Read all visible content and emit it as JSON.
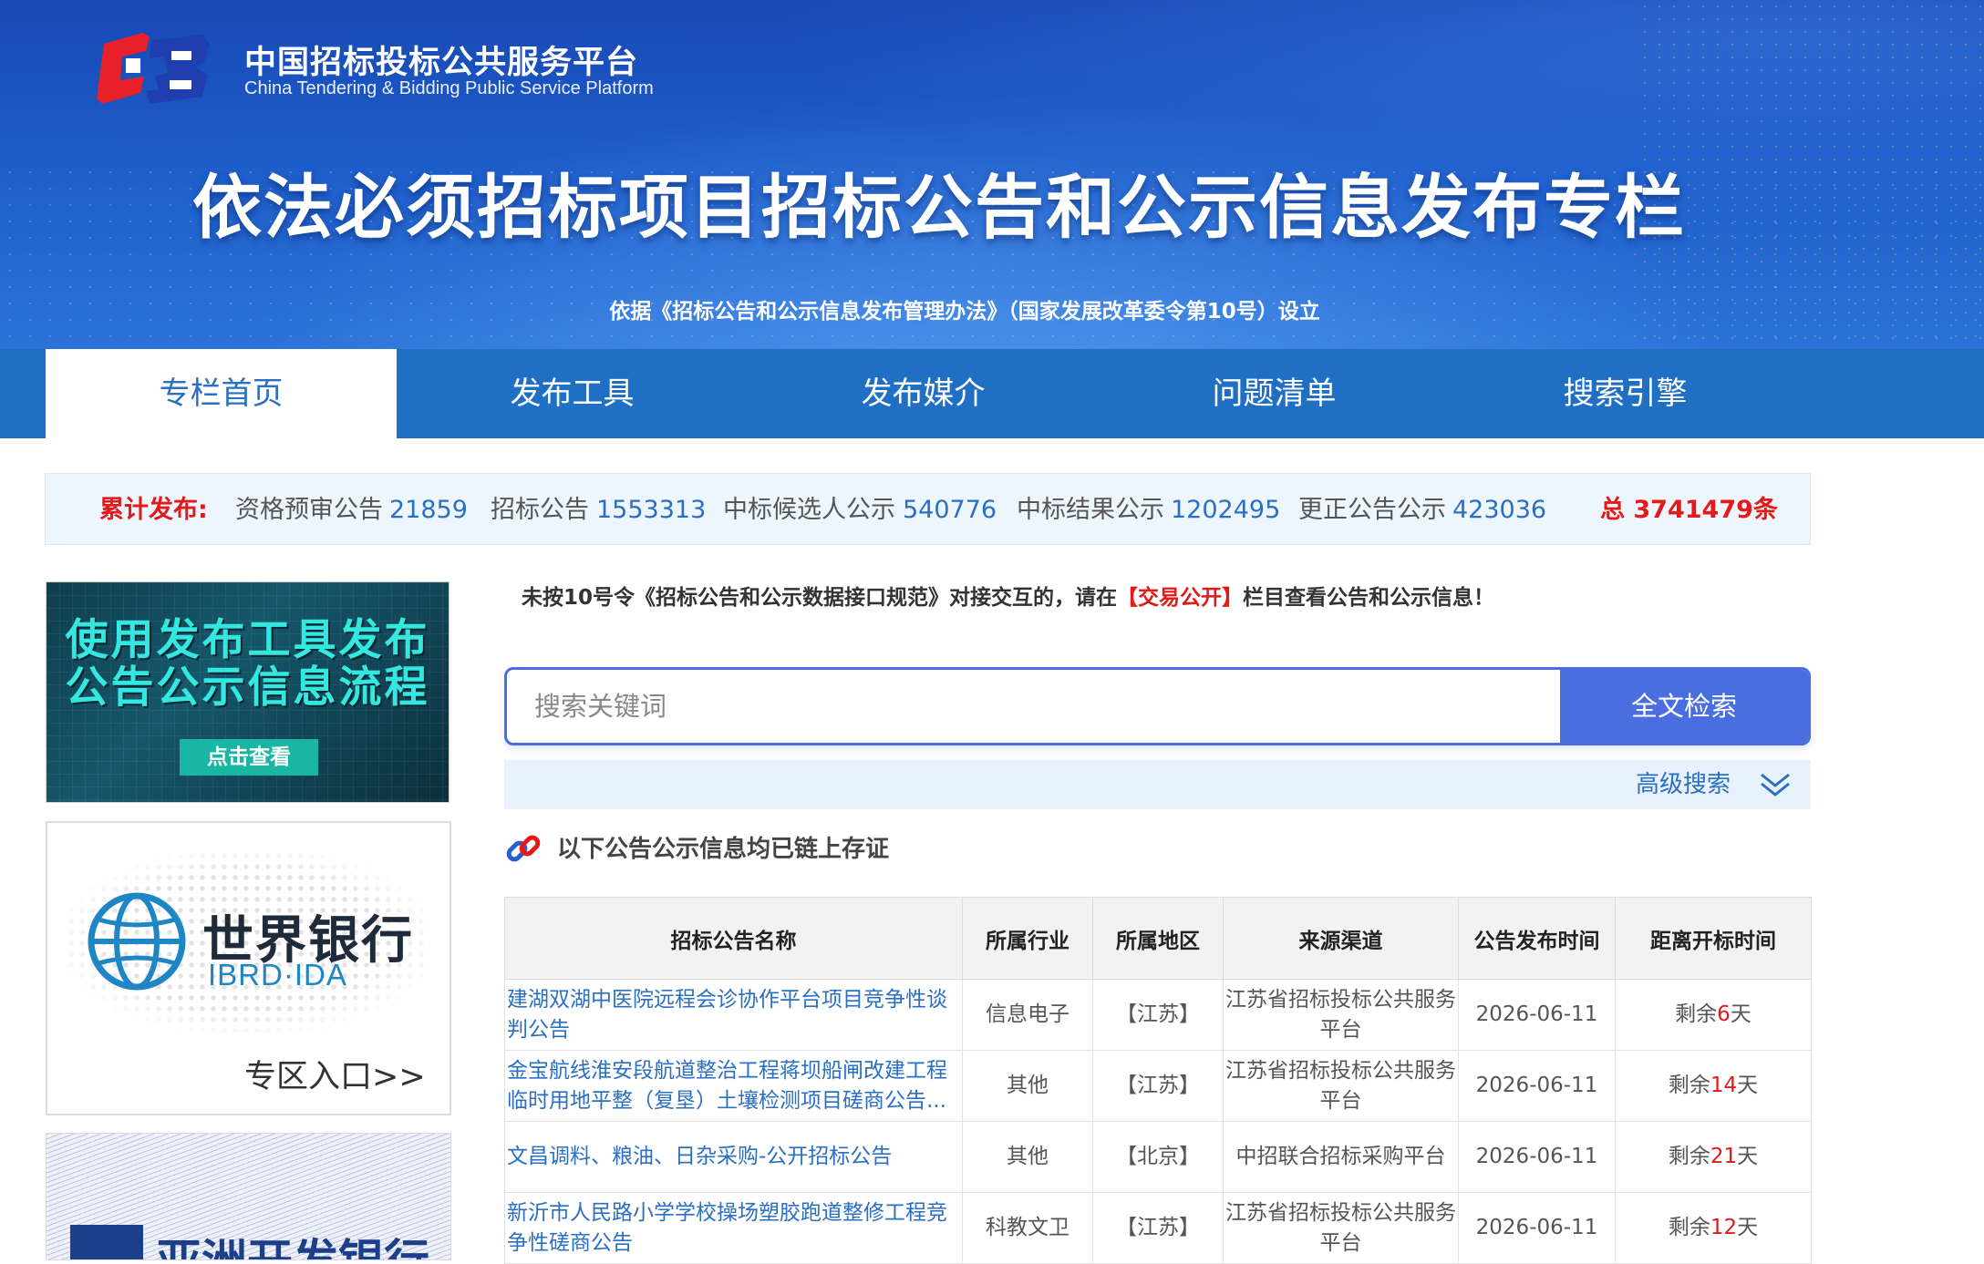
{
  "header": {
    "logo_cn": "中国招标投标公共服务平台",
    "logo_en": "China Tendering & Bidding Public Service Platform",
    "title": "依法必须招标项目招标公告和公示信息发布专栏",
    "subtitle": "依据《招标公告和公示信息发布管理办法》（国家发展改革委令第10号）设立"
  },
  "nav": [
    {
      "label": "专栏首页",
      "active": true
    },
    {
      "label": "发布工具"
    },
    {
      "label": "发布媒介"
    },
    {
      "label": "问题清单"
    },
    {
      "label": "搜索引擎"
    }
  ],
  "stats": {
    "label": "累计发布:",
    "items": [
      {
        "name": "资格预审公告",
        "count": "21859"
      },
      {
        "name": "招标公告",
        "count": "1553313"
      },
      {
        "name": "中标候选人公示",
        "count": "540776"
      },
      {
        "name": "中标结果公示",
        "count": "1202495"
      },
      {
        "name": "更正公告公示",
        "count": "423036"
      }
    ],
    "total": "总 3741479条"
  },
  "ads": {
    "tool": {
      "line1": "使用发布工具发布",
      "line2": "公告公示信息流程",
      "button": "点击查看"
    },
    "worldbank": {
      "title": "世界银行",
      "sub": "IBRD·IDA",
      "entry": "专区入口>>"
    },
    "adb": {
      "title": "亚洲开发银行"
    }
  },
  "notice": {
    "before": "未按10号令《招标公告和公示数据接口规范》对接交互的，请在",
    "highlight": "【交易公开】",
    "after": "栏目查看公告和公示信息！"
  },
  "search": {
    "placeholder": "搜索关键词",
    "button": "全文检索",
    "advanced": "高级搜索"
  },
  "chain_note": "以下公告公示信息均已链上存证",
  "colors": {
    "nav_blue": "#1f6fc5",
    "link_blue": "#2a6fc2",
    "search_blue": "#4a6ee0",
    "alert_red": "#e31a1a"
  },
  "table": {
    "headers": [
      "招标公告名称",
      "所属行业",
      "所属地区",
      "来源渠道",
      "公告发布时间",
      "距离开标时间"
    ],
    "rows": [
      {
        "name": "建湖双湖中医院远程会诊协作平台项目竞争性谈判公告",
        "industry": "信息电子",
        "region": "【江苏】",
        "source": "江苏省招标投标公共服务平台",
        "date": "2026-06-11",
        "remain_pre": "剩余",
        "remain_num": "6",
        "remain_post": "天"
      },
      {
        "name": "金宝航线淮安段航道整治工程蒋坝船闸改建工程临时用地平整（复垦）土壤检测项目磋商公告...",
        "industry": "其他",
        "region": "【江苏】",
        "source": "江苏省招标投标公共服务平台",
        "date": "2026-06-11",
        "remain_pre": "剩余",
        "remain_num": "14",
        "remain_post": "天"
      },
      {
        "name": "文昌调料、粮油、日杂采购-公开招标公告",
        "industry": "其他",
        "region": "【北京】",
        "source": "中招联合招标采购平台",
        "date": "2026-06-11",
        "remain_pre": "剩余",
        "remain_num": "21",
        "remain_post": "天"
      },
      {
        "name": "新沂市人民路小学学校操场塑胶跑道整修工程竞争性磋商公告",
        "industry": "科教文卫",
        "region": "【江苏】",
        "source": "江苏省招标投标公共服务平台",
        "date": "2026-06-11",
        "remain_pre": "剩余",
        "remain_num": "12",
        "remain_post": "天"
      }
    ]
  }
}
